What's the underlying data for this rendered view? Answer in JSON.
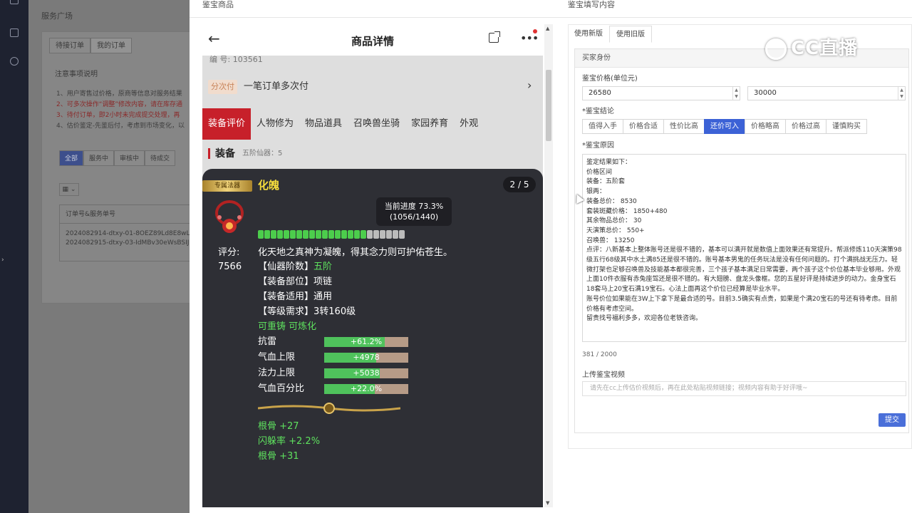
{
  "bg": {
    "title": "服务广场",
    "tabs": [
      "待接订单",
      "我的订单"
    ],
    "section_title": "注意事项说明",
    "notes": [
      "1、用户寄售过价格，原商等信息对服务结果",
      "2、可多次操作“调整”修改内容，请在库存通",
      "3、待付订单，即2小时未完成提交处理，再",
      "4、估价鉴定-先鉴后付，考虑到市场变化，以"
    ],
    "filters": [
      "全部",
      "服务中",
      "审核中",
      "待成交"
    ],
    "select_label": "▦ ⌄",
    "table_header": "订单号&服务单号",
    "rows": [
      "2024082914-dtxy-01-8OEZ89Ld8E8wL",
      "2024082915-dtxy-03-IdMBv30eWsBSIJ"
    ]
  },
  "mid": {
    "title": "鉴宝商品",
    "phone": {
      "title": "商品详情",
      "back_icon": "arrow-left",
      "id_text": "编 号: 103561",
      "pay_badge": "分次付",
      "pay_text": "一笔订单多次付",
      "tabs": [
        "装备评价",
        "人物修为",
        "物品道具",
        "召唤兽坐骑",
        "家园养育",
        "外观"
      ],
      "equip_title": "装备",
      "equip_sub": "五阶仙器：5"
    },
    "card": {
      "badge": "专属法器",
      "name": "化魄",
      "page": "2 / 5",
      "progress_label": "当前进度 73.3%",
      "progress_detail": "(1056/1440)",
      "progress_fraction": 0.733,
      "score_label": "评分:",
      "score_value": "7566",
      "desc": "化天地之真神为凝魄，得其念力则可护佑苍生。",
      "attrs": [
        {
          "label": "【仙器阶数】",
          "value": "五阶",
          "green": true
        },
        {
          "label": "【装备部位】",
          "value": "项链",
          "green": false
        },
        {
          "label": "【装备适用】",
          "value": "通用",
          "green": false
        },
        {
          "label": "【等级需求】",
          "value": "3转160级",
          "green": false
        }
      ],
      "recast": "可重铸 可炼化",
      "stats": [
        {
          "name": "抗雷",
          "value": "+61.2%",
          "fill": 0.72
        },
        {
          "name": "气血上限",
          "value": "+4978",
          "fill": 0.62
        },
        {
          "name": "法力上限",
          "value": "+5038",
          "fill": 0.66
        },
        {
          "name": "气血百分比",
          "value": "+22.0%",
          "fill": 0.6
        }
      ],
      "extras": [
        "根骨 +27",
        "闪躲率 +2.2%",
        "根骨 +31"
      ]
    }
  },
  "right": {
    "title": "鉴宝填写内容",
    "tabs": [
      "使用新版",
      "使用旧版"
    ],
    "active_tab": 1,
    "form_head": "买家身份",
    "price_label": "鉴宝价格(单位元)",
    "price_min": "26580",
    "price_max": "30000",
    "conclusion_label": "*鉴宝结论",
    "conclusions": [
      "值得入手",
      "价格合适",
      "性价比高",
      "还价可入",
      "价格略高",
      "价格过高",
      "谨慎购买"
    ],
    "active_conclusion": 3,
    "reason_label": "*鉴宝原因",
    "reason_lines": [
      "鉴定结果如下：",
      "价格区间",
      "装备：五阶套",
      "银两：",
      "装备总价：  8530",
      "套装斑藏价格：  1850+480",
      "其余物品总价：  30",
      "天演策总价：  550+",
      "召唤兽：  13250",
      "点评：八新基本上整体账号还是很不错的，基本可以满开就是数值上面效果还有常提升。帮派修炼110天演策98级五行68级其中水土满85还是很不错的。账号基本男鬼的任务玩法是没有任何问题的。打个满挑战无压力。轻微打架也足够召唤兽及技能基本都很完善，三个孩子基本满足日常需要，两个孩子这个价位基本毕业够用。外观上面10件衣服有赤兔座驾还是很不错的。有大翅膀、盘龙头像框。您的五星好评是持续进步的动力。金身宝石18套马上20宝石满19宝石。心法上面再这个价位已经算是毕业水平。",
      "账号价位如果能在3W上下拿下是最合适的号。目前3.5确实有点贵，如果是个满20宝石的号还有待考虑。目前价格有考虑空间。",
      "留贵找号福利多多，欢迎各位老铁咨询。"
    ],
    "char_count": "381 / 2000",
    "video_label": "上传鉴宝视频",
    "video_placeholder": "请先在cc上传估价视频后，再在此处粘贴视频链接；视频内容有助于好评哦~",
    "submit": "提交"
  },
  "watermark": "CC直播"
}
